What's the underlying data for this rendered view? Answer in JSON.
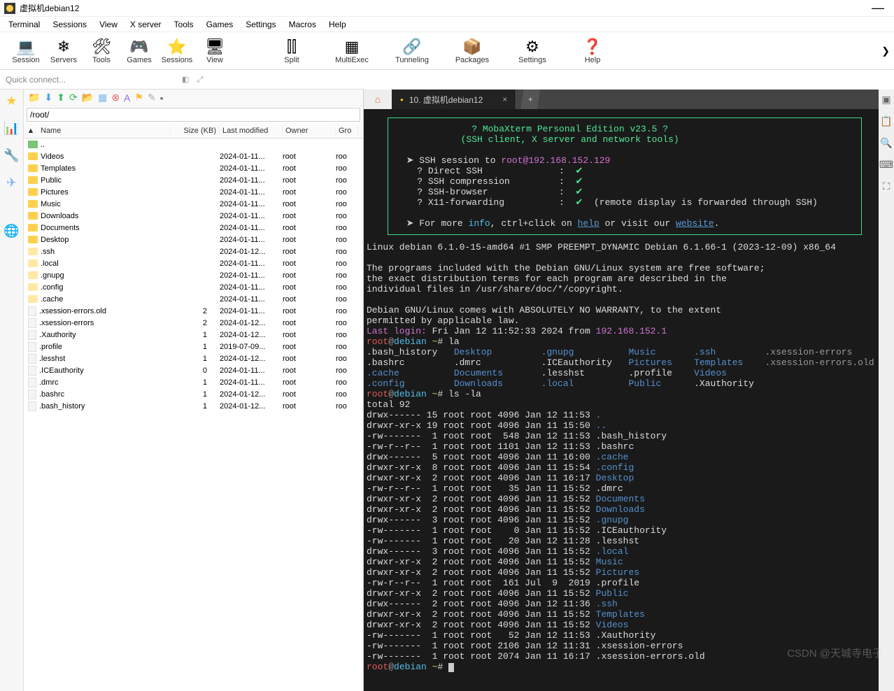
{
  "window": {
    "title": "虚拟机debian12"
  },
  "menubar": [
    "Terminal",
    "Sessions",
    "View",
    "X server",
    "Tools",
    "Games",
    "Settings",
    "Macros",
    "Help"
  ],
  "toolbar": [
    {
      "icon": "💻",
      "label": "Session"
    },
    {
      "icon": "❄",
      "label": "Servers"
    },
    {
      "icon": "🛠",
      "label": "Tools"
    },
    {
      "icon": "🎮",
      "label": "Games"
    },
    {
      "icon": "⭐",
      "label": "Sessions"
    },
    {
      "icon": "🖥",
      "label": "View"
    }
  ],
  "toolbar_extra": [
    {
      "icon": "⫿⫿",
      "label": "Split"
    },
    {
      "icon": "▦",
      "label": "MultiExec"
    },
    {
      "icon": "🔗",
      "label": "Tunneling"
    },
    {
      "icon": "📦",
      "label": "Packages"
    },
    {
      "icon": "⚙",
      "label": "Settings"
    },
    {
      "icon": "❓",
      "label": "Help"
    }
  ],
  "quick_connect": {
    "placeholder": "Quick connect..."
  },
  "sidebar": {
    "path": "/root/",
    "columns": {
      "name": "Name",
      "size": "Size (KB)",
      "date": "Last modified",
      "owner": "Owner",
      "group": "Gro"
    },
    "files": [
      {
        "type": "up",
        "name": ".."
      },
      {
        "type": "folder",
        "name": "Videos",
        "date": "2024-01-11...",
        "owner": "root",
        "group": "roo"
      },
      {
        "type": "folder",
        "name": "Templates",
        "date": "2024-01-11...",
        "owner": "root",
        "group": "roo"
      },
      {
        "type": "folder",
        "name": "Public",
        "date": "2024-01-11...",
        "owner": "root",
        "group": "roo"
      },
      {
        "type": "folder",
        "name": "Pictures",
        "date": "2024-01-11...",
        "owner": "root",
        "group": "roo"
      },
      {
        "type": "folder",
        "name": "Music",
        "date": "2024-01-11...",
        "owner": "root",
        "group": "roo"
      },
      {
        "type": "folder",
        "name": "Downloads",
        "date": "2024-01-11...",
        "owner": "root",
        "group": "roo"
      },
      {
        "type": "folder",
        "name": "Documents",
        "date": "2024-01-11...",
        "owner": "root",
        "group": "roo"
      },
      {
        "type": "folder",
        "name": "Desktop",
        "date": "2024-01-11...",
        "owner": "root",
        "group": "roo"
      },
      {
        "type": "hfolder",
        "name": ".ssh",
        "date": "2024-01-12...",
        "owner": "root",
        "group": "roo"
      },
      {
        "type": "hfolder",
        "name": ".local",
        "date": "2024-01-11...",
        "owner": "root",
        "group": "roo"
      },
      {
        "type": "hfolder",
        "name": ".gnupg",
        "date": "2024-01-11...",
        "owner": "root",
        "group": "roo"
      },
      {
        "type": "hfolder",
        "name": ".config",
        "date": "2024-01-11...",
        "owner": "root",
        "group": "roo"
      },
      {
        "type": "hfolder",
        "name": ".cache",
        "date": "2024-01-11...",
        "owner": "root",
        "group": "roo"
      },
      {
        "type": "hfile",
        "name": ".xsession-errors.old",
        "size": "2",
        "date": "2024-01-11...",
        "owner": "root",
        "group": "roo"
      },
      {
        "type": "hfile",
        "name": ".xsession-errors",
        "size": "2",
        "date": "2024-01-12...",
        "owner": "root",
        "group": "roo"
      },
      {
        "type": "hfile",
        "name": ".Xauthority",
        "size": "1",
        "date": "2024-01-12...",
        "owner": "root",
        "group": "roo"
      },
      {
        "type": "hfile",
        "name": ".profile",
        "size": "1",
        "date": "2019-07-09...",
        "owner": "root",
        "group": "roo"
      },
      {
        "type": "hfile",
        "name": ".lesshst",
        "size": "1",
        "date": "2024-01-12...",
        "owner": "root",
        "group": "roo"
      },
      {
        "type": "hfile",
        "name": ".ICEauthority",
        "size": "0",
        "date": "2024-01-11...",
        "owner": "root",
        "group": "roo"
      },
      {
        "type": "hfile",
        "name": ".dmrc",
        "size": "1",
        "date": "2024-01-11...",
        "owner": "root",
        "group": "roo"
      },
      {
        "type": "hfile",
        "name": ".bashrc",
        "size": "1",
        "date": "2024-01-12...",
        "owner": "root",
        "group": "roo"
      },
      {
        "type": "hfile",
        "name": ".bash_history",
        "size": "1",
        "date": "2024-01-12...",
        "owner": "root",
        "group": "roo"
      }
    ]
  },
  "tab": {
    "label": "10. 虚拟机debian12"
  },
  "terminal": {
    "banner": {
      "title": "? MobaXterm Personal Edition v23.5 ?",
      "subtitle": "(SSH client, X server and network tools)",
      "session_to": "SSH session to ",
      "session_host": "root@192.168.152.129",
      "rows": [
        {
          "k": "? Direct SSH",
          "ok": "✔"
        },
        {
          "k": "? SSH compression",
          "ok": "✔"
        },
        {
          "k": "? SSH-browser",
          "ok": "✔"
        },
        {
          "k": "? X11-forwarding",
          "ok": "✔",
          "extra": "(remote display is forwarded through SSH)"
        }
      ],
      "more1": "For more ",
      "info": "info",
      "more2": ", ctrl+click on ",
      "help": "help",
      "more3": " or visit our ",
      "website": "website",
      "dot": "."
    },
    "motd": {
      "l1": "Linux debian 6.1.0-15-amd64 #1 SMP PREEMPT_DYNAMIC Debian 6.1.66-1 (2023-12-09) x86_64",
      "l2": "The programs included with the Debian GNU/Linux system are free software;",
      "l3": "the exact distribution terms for each program are described in the",
      "l4": "individual files in /usr/share/doc/*/copyright.",
      "l5": "Debian GNU/Linux comes with ABSOLUTELY NO WARRANTY, to the extent",
      "l6": "permitted by applicable law."
    },
    "lastlogin": {
      "pre": "Last login:",
      "txt": " Fri Jan 12 11:52:33 2024 from ",
      "ip": "192.168.152.1"
    },
    "prompt1": {
      "user": "root",
      "at": "@",
      "host": "debian ",
      "tilde": "~",
      "hash": "# ",
      "cmd": "la"
    },
    "la_cols": {
      "c1": [
        ".bash_history",
        ".bashrc",
        ".cache",
        ".config"
      ],
      "c2": [
        "Desktop",
        ".dmrc",
        "Documents",
        "Downloads"
      ],
      "c3": [
        ".gnupg",
        ".ICEauthority",
        ".lesshst",
        ".local"
      ],
      "c4": [
        "Music",
        "Pictures",
        ".profile",
        "Public"
      ],
      "c5": [
        ".ssh",
        "Templates",
        "Videos",
        ".Xauthority"
      ],
      "c6": [
        ".xsession-errors",
        ".xsession-errors.old",
        "",
        ""
      ]
    },
    "prompt2": {
      "cmd": "ls -la"
    },
    "total": "total 92",
    "ls": [
      {
        "perm": "drwx------",
        "n": "15",
        "o": "root",
        "g": "root",
        "sz": "4096",
        "dt": "Jan 12 11:53",
        "name": ".",
        "cls": "c-darkblue"
      },
      {
        "perm": "drwxr-xr-x",
        "n": "19",
        "o": "root",
        "g": "root",
        "sz": "4096",
        "dt": "Jan 11 15:50",
        "name": "..",
        "cls": "c-darkblue"
      },
      {
        "perm": "-rw-------",
        "n": " 1",
        "o": "root",
        "g": "root",
        "sz": " 548",
        "dt": "Jan 12 11:53",
        "name": ".bash_history",
        "cls": "c-white"
      },
      {
        "perm": "-rw-r--r--",
        "n": " 1",
        "o": "root",
        "g": "root",
        "sz": "1101",
        "dt": "Jan 12 11:53",
        "name": ".bashrc",
        "cls": "c-white"
      },
      {
        "perm": "drwx------",
        "n": " 5",
        "o": "root",
        "g": "root",
        "sz": "4096",
        "dt": "Jan 11 16:00",
        "name": ".cache",
        "cls": "c-darkblue"
      },
      {
        "perm": "drwxr-xr-x",
        "n": " 8",
        "o": "root",
        "g": "root",
        "sz": "4096",
        "dt": "Jan 11 15:54",
        "name": ".config",
        "cls": "c-darkblue"
      },
      {
        "perm": "drwxr-xr-x",
        "n": " 2",
        "o": "root",
        "g": "root",
        "sz": "4096",
        "dt": "Jan 11 16:17",
        "name": "Desktop",
        "cls": "c-darkblue"
      },
      {
        "perm": "-rw-r--r--",
        "n": " 1",
        "o": "root",
        "g": "root",
        "sz": "  35",
        "dt": "Jan 11 15:52",
        "name": ".dmrc",
        "cls": "c-white"
      },
      {
        "perm": "drwxr-xr-x",
        "n": " 2",
        "o": "root",
        "g": "root",
        "sz": "4096",
        "dt": "Jan 11 15:52",
        "name": "Documents",
        "cls": "c-darkblue"
      },
      {
        "perm": "drwxr-xr-x",
        "n": " 2",
        "o": "root",
        "g": "root",
        "sz": "4096",
        "dt": "Jan 11 15:52",
        "name": "Downloads",
        "cls": "c-darkblue"
      },
      {
        "perm": "drwx------",
        "n": " 3",
        "o": "root",
        "g": "root",
        "sz": "4096",
        "dt": "Jan 11 15:52",
        "name": ".gnupg",
        "cls": "c-darkblue"
      },
      {
        "perm": "-rw-------",
        "n": " 1",
        "o": "root",
        "g": "root",
        "sz": "   0",
        "dt": "Jan 11 15:52",
        "name": ".ICEauthority",
        "cls": "c-white"
      },
      {
        "perm": "-rw-------",
        "n": " 1",
        "o": "root",
        "g": "root",
        "sz": "  20",
        "dt": "Jan 12 11:28",
        "name": ".lesshst",
        "cls": "c-white"
      },
      {
        "perm": "drwx------",
        "n": " 3",
        "o": "root",
        "g": "root",
        "sz": "4096",
        "dt": "Jan 11 15:52",
        "name": ".local",
        "cls": "c-darkblue"
      },
      {
        "perm": "drwxr-xr-x",
        "n": " 2",
        "o": "root",
        "g": "root",
        "sz": "4096",
        "dt": "Jan 11 15:52",
        "name": "Music",
        "cls": "c-darkblue"
      },
      {
        "perm": "drwxr-xr-x",
        "n": " 2",
        "o": "root",
        "g": "root",
        "sz": "4096",
        "dt": "Jan 11 15:52",
        "name": "Pictures",
        "cls": "c-darkblue"
      },
      {
        "perm": "-rw-r--r--",
        "n": " 1",
        "o": "root",
        "g": "root",
        "sz": " 161",
        "dt": "Jul  9  2019",
        "name": ".profile",
        "cls": "c-white"
      },
      {
        "perm": "drwxr-xr-x",
        "n": " 2",
        "o": "root",
        "g": "root",
        "sz": "4096",
        "dt": "Jan 11 15:52",
        "name": "Public",
        "cls": "c-darkblue"
      },
      {
        "perm": "drwx------",
        "n": " 2",
        "o": "root",
        "g": "root",
        "sz": "4096",
        "dt": "Jan 12 11:36",
        "name": ".ssh",
        "cls": "c-darkblue"
      },
      {
        "perm": "drwxr-xr-x",
        "n": " 2",
        "o": "root",
        "g": "root",
        "sz": "4096",
        "dt": "Jan 11 15:52",
        "name": "Templates",
        "cls": "c-darkblue"
      },
      {
        "perm": "drwxr-xr-x",
        "n": " 2",
        "o": "root",
        "g": "root",
        "sz": "4096",
        "dt": "Jan 11 15:52",
        "name": "Videos",
        "cls": "c-darkblue"
      },
      {
        "perm": "-rw-------",
        "n": " 1",
        "o": "root",
        "g": "root",
        "sz": "  52",
        "dt": "Jan 12 11:53",
        "name": ".Xauthority",
        "cls": "c-white"
      },
      {
        "perm": "-rw-------",
        "n": " 1",
        "o": "root",
        "g": "root",
        "sz": "2106",
        "dt": "Jan 12 11:31",
        "name": ".xsession-errors",
        "cls": "c-white"
      },
      {
        "perm": "-rw-------",
        "n": " 1",
        "o": "root",
        "g": "root",
        "sz": "2074",
        "dt": "Jan 11 16:17",
        "name": ".xsession-errors.old",
        "cls": "c-white"
      }
    ]
  },
  "watermark": "CSDN @天城寺电子"
}
